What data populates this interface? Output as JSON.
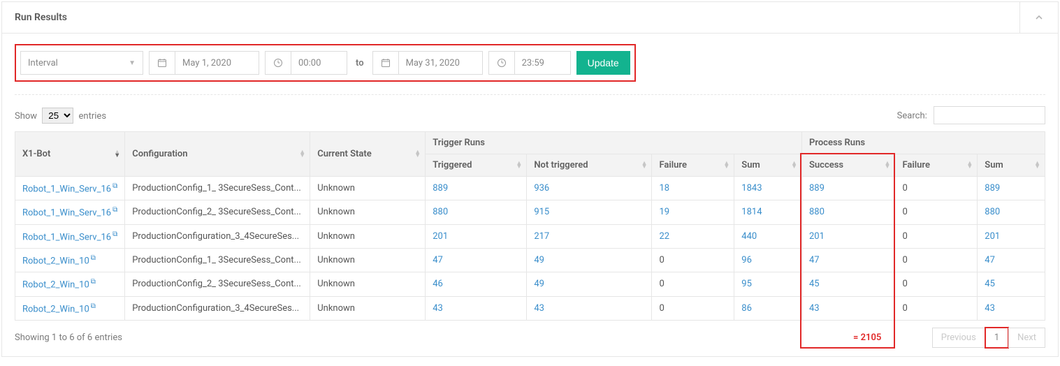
{
  "panel": {
    "title": "Run Results"
  },
  "filter": {
    "mode": "Interval",
    "date_from": "May 1, 2020",
    "time_from": "00:00",
    "to_label": "to",
    "date_to": "May 31, 2020",
    "time_to": "23:59",
    "update_label": "Update"
  },
  "table_opts": {
    "show_label_pre": "Show",
    "show_label_post": "entries",
    "show_value": "25",
    "search_label": "Search:"
  },
  "columns": {
    "bot": "X1-Bot",
    "config": "Configuration",
    "state": "Current State",
    "group_trigger": "Trigger Runs",
    "group_process": "Process Runs",
    "triggered": "Triggered",
    "not_triggered": "Not triggered",
    "t_failure": "Failure",
    "t_sum": "Sum",
    "success": "Success",
    "p_failure": "Failure",
    "p_sum": "Sum"
  },
  "rows": [
    {
      "bot": "Robot_1_Win_Serv_16",
      "config": "ProductionConfig_1_ 3SecureSess_Cont...",
      "state": "Unknown",
      "triggered": "889",
      "not_triggered": "936",
      "t_failure": "18",
      "t_sum": "1843",
      "success": "889",
      "p_failure": "0",
      "p_sum": "889"
    },
    {
      "bot": "Robot_1_Win_Serv_16",
      "config": "ProductionConfig_2_ 3SecureSess_Cont...",
      "state": "Unknown",
      "triggered": "880",
      "not_triggered": "915",
      "t_failure": "19",
      "t_sum": "1814",
      "success": "880",
      "p_failure": "0",
      "p_sum": "880"
    },
    {
      "bot": "Robot_1_Win_Serv_16",
      "config": "ProductionConfiguration_3_4SecureSes...",
      "state": "Unknown",
      "triggered": "201",
      "not_triggered": "217",
      "t_failure": "22",
      "t_sum": "440",
      "success": "201",
      "p_failure": "0",
      "p_sum": "201"
    },
    {
      "bot": "Robot_2_Win_10",
      "config": "ProductionConfig_1_ 3SecureSess_Cont...",
      "state": "Unknown",
      "triggered": "47",
      "not_triggered": "49",
      "t_failure": "0",
      "t_sum": "96",
      "success": "47",
      "p_failure": "0",
      "p_sum": "47"
    },
    {
      "bot": "Robot_2_Win_10",
      "config": "ProductionConfig_2_ 3SecureSess_Cont...",
      "state": "Unknown",
      "triggered": "46",
      "not_triggered": "49",
      "t_failure": "0",
      "t_sum": "95",
      "success": "45",
      "p_failure": "0",
      "p_sum": "45"
    },
    {
      "bot": "Robot_2_Win_10",
      "config": "ProductionConfiguration_3_4SecureSes...",
      "state": "Unknown",
      "triggered": "43",
      "not_triggered": "43",
      "t_failure": "0",
      "t_sum": "86",
      "success": "43",
      "p_failure": "0",
      "p_sum": "43"
    }
  ],
  "totals": {
    "success_sum": "= 2105"
  },
  "footer": {
    "info": "Showing 1 to 6 of 6 entries",
    "prev": "Previous",
    "page": "1",
    "next": "Next"
  }
}
